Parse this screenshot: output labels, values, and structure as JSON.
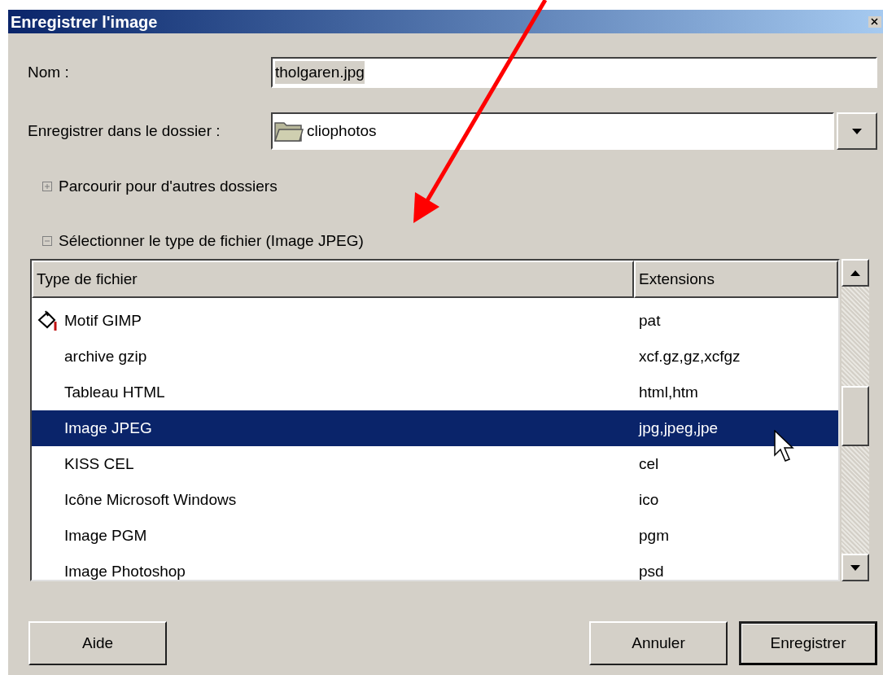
{
  "window": {
    "title": "Enregistrer l'image"
  },
  "name_field": {
    "label": "Nom :",
    "value": "tholgaren.jpg"
  },
  "folder_field": {
    "label": "Enregistrer dans le dossier :",
    "value": "cliophotos"
  },
  "expanders": [
    {
      "label": "Parcourir pour d'autres dossiers",
      "expanded": false
    },
    {
      "label": "Sélectionner le type de fichier (Image JPEG)",
      "expanded": true
    }
  ],
  "table": {
    "columns": [
      "Type de fichier",
      "Extensions"
    ],
    "rows": [
      {
        "type": "Motif GIMP",
        "extensions": "pat",
        "has_icon": true,
        "selected": false
      },
      {
        "type": "archive gzip",
        "extensions": "xcf.gz,gz,xcfgz",
        "has_icon": false,
        "selected": false
      },
      {
        "type": "Tableau HTML",
        "extensions": "html,htm",
        "has_icon": false,
        "selected": false
      },
      {
        "type": "Image JPEG",
        "extensions": "jpg,jpeg,jpe",
        "has_icon": false,
        "selected": true
      },
      {
        "type": "KISS CEL",
        "extensions": "cel",
        "has_icon": false,
        "selected": false
      },
      {
        "type": "Icône Microsoft Windows",
        "extensions": "ico",
        "has_icon": false,
        "selected": false
      },
      {
        "type": "Image PGM",
        "extensions": "pgm",
        "has_icon": false,
        "selected": false
      },
      {
        "type": "Image Photoshop",
        "extensions": "psd",
        "has_icon": false,
        "selected": false
      }
    ]
  },
  "buttons": [
    {
      "label": "Aide",
      "default": false
    },
    {
      "label": "Annuler",
      "default": false
    },
    {
      "label": "Enregistrer",
      "default": true
    }
  ]
}
